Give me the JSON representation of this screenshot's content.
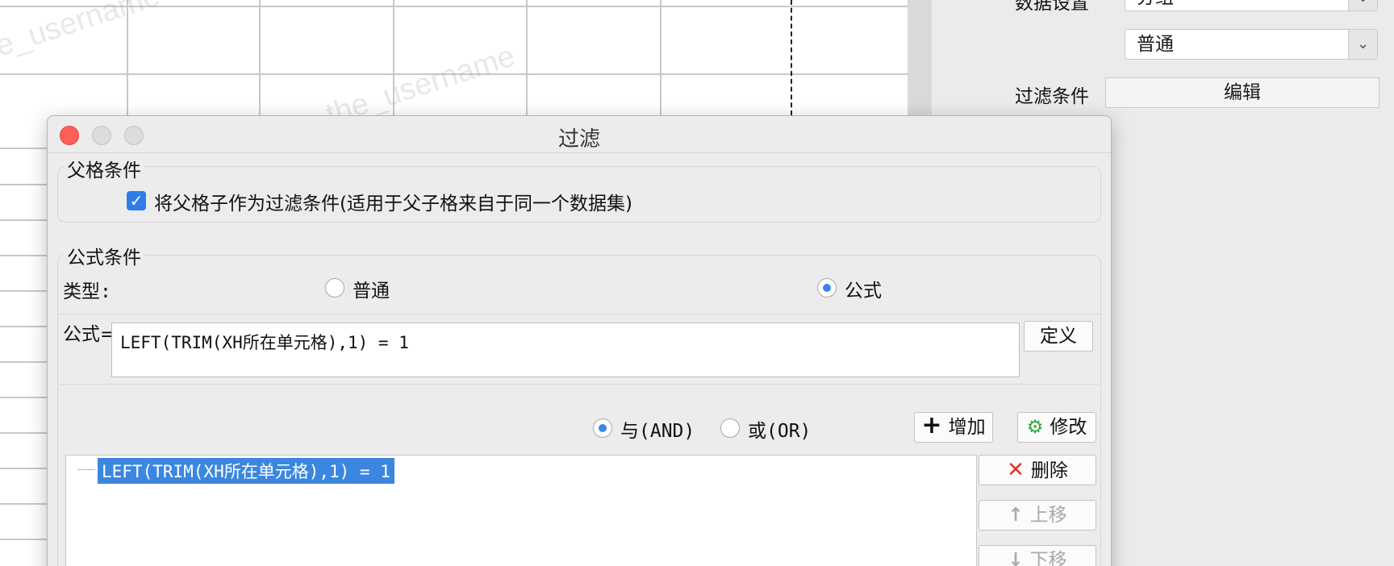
{
  "right_panel": {
    "row1_label": "数据设置",
    "row1_value": "分组",
    "row2_value": "普通",
    "filter_label": "过滤条件",
    "filter_button": "编辑"
  },
  "watermark": "the_username",
  "dialog": {
    "title": "过滤",
    "parent_group": {
      "title": "父格条件",
      "checkbox_checked": true,
      "checkbox_label": "将父格子作为过滤条件(适用于父子格来自于同一个数据集)"
    },
    "formula_group": {
      "title": "公式条件",
      "type_label": "类型:",
      "type_options": [
        "普通",
        "公式"
      ],
      "type_selected": "公式",
      "formula_label": "公式=",
      "formula_value": "LEFT(TRIM(XH所在单元格),1) = 1",
      "define_button": "定义",
      "logic_options": [
        "与(AND)",
        "或(OR)"
      ],
      "logic_selected": "与(AND)",
      "add_button": "增加",
      "modify_button": "修改",
      "delete_button": "删除",
      "up_button": "上移",
      "down_button": "下移",
      "conditions": [
        "LEFT(TRIM(XH所在单元格),1) = 1"
      ]
    }
  },
  "colors": {
    "close": "#fe5f57",
    "accent": "#3b87e0",
    "delete_icon": "#e0332e",
    "modify_icon": "#2aa63b"
  }
}
